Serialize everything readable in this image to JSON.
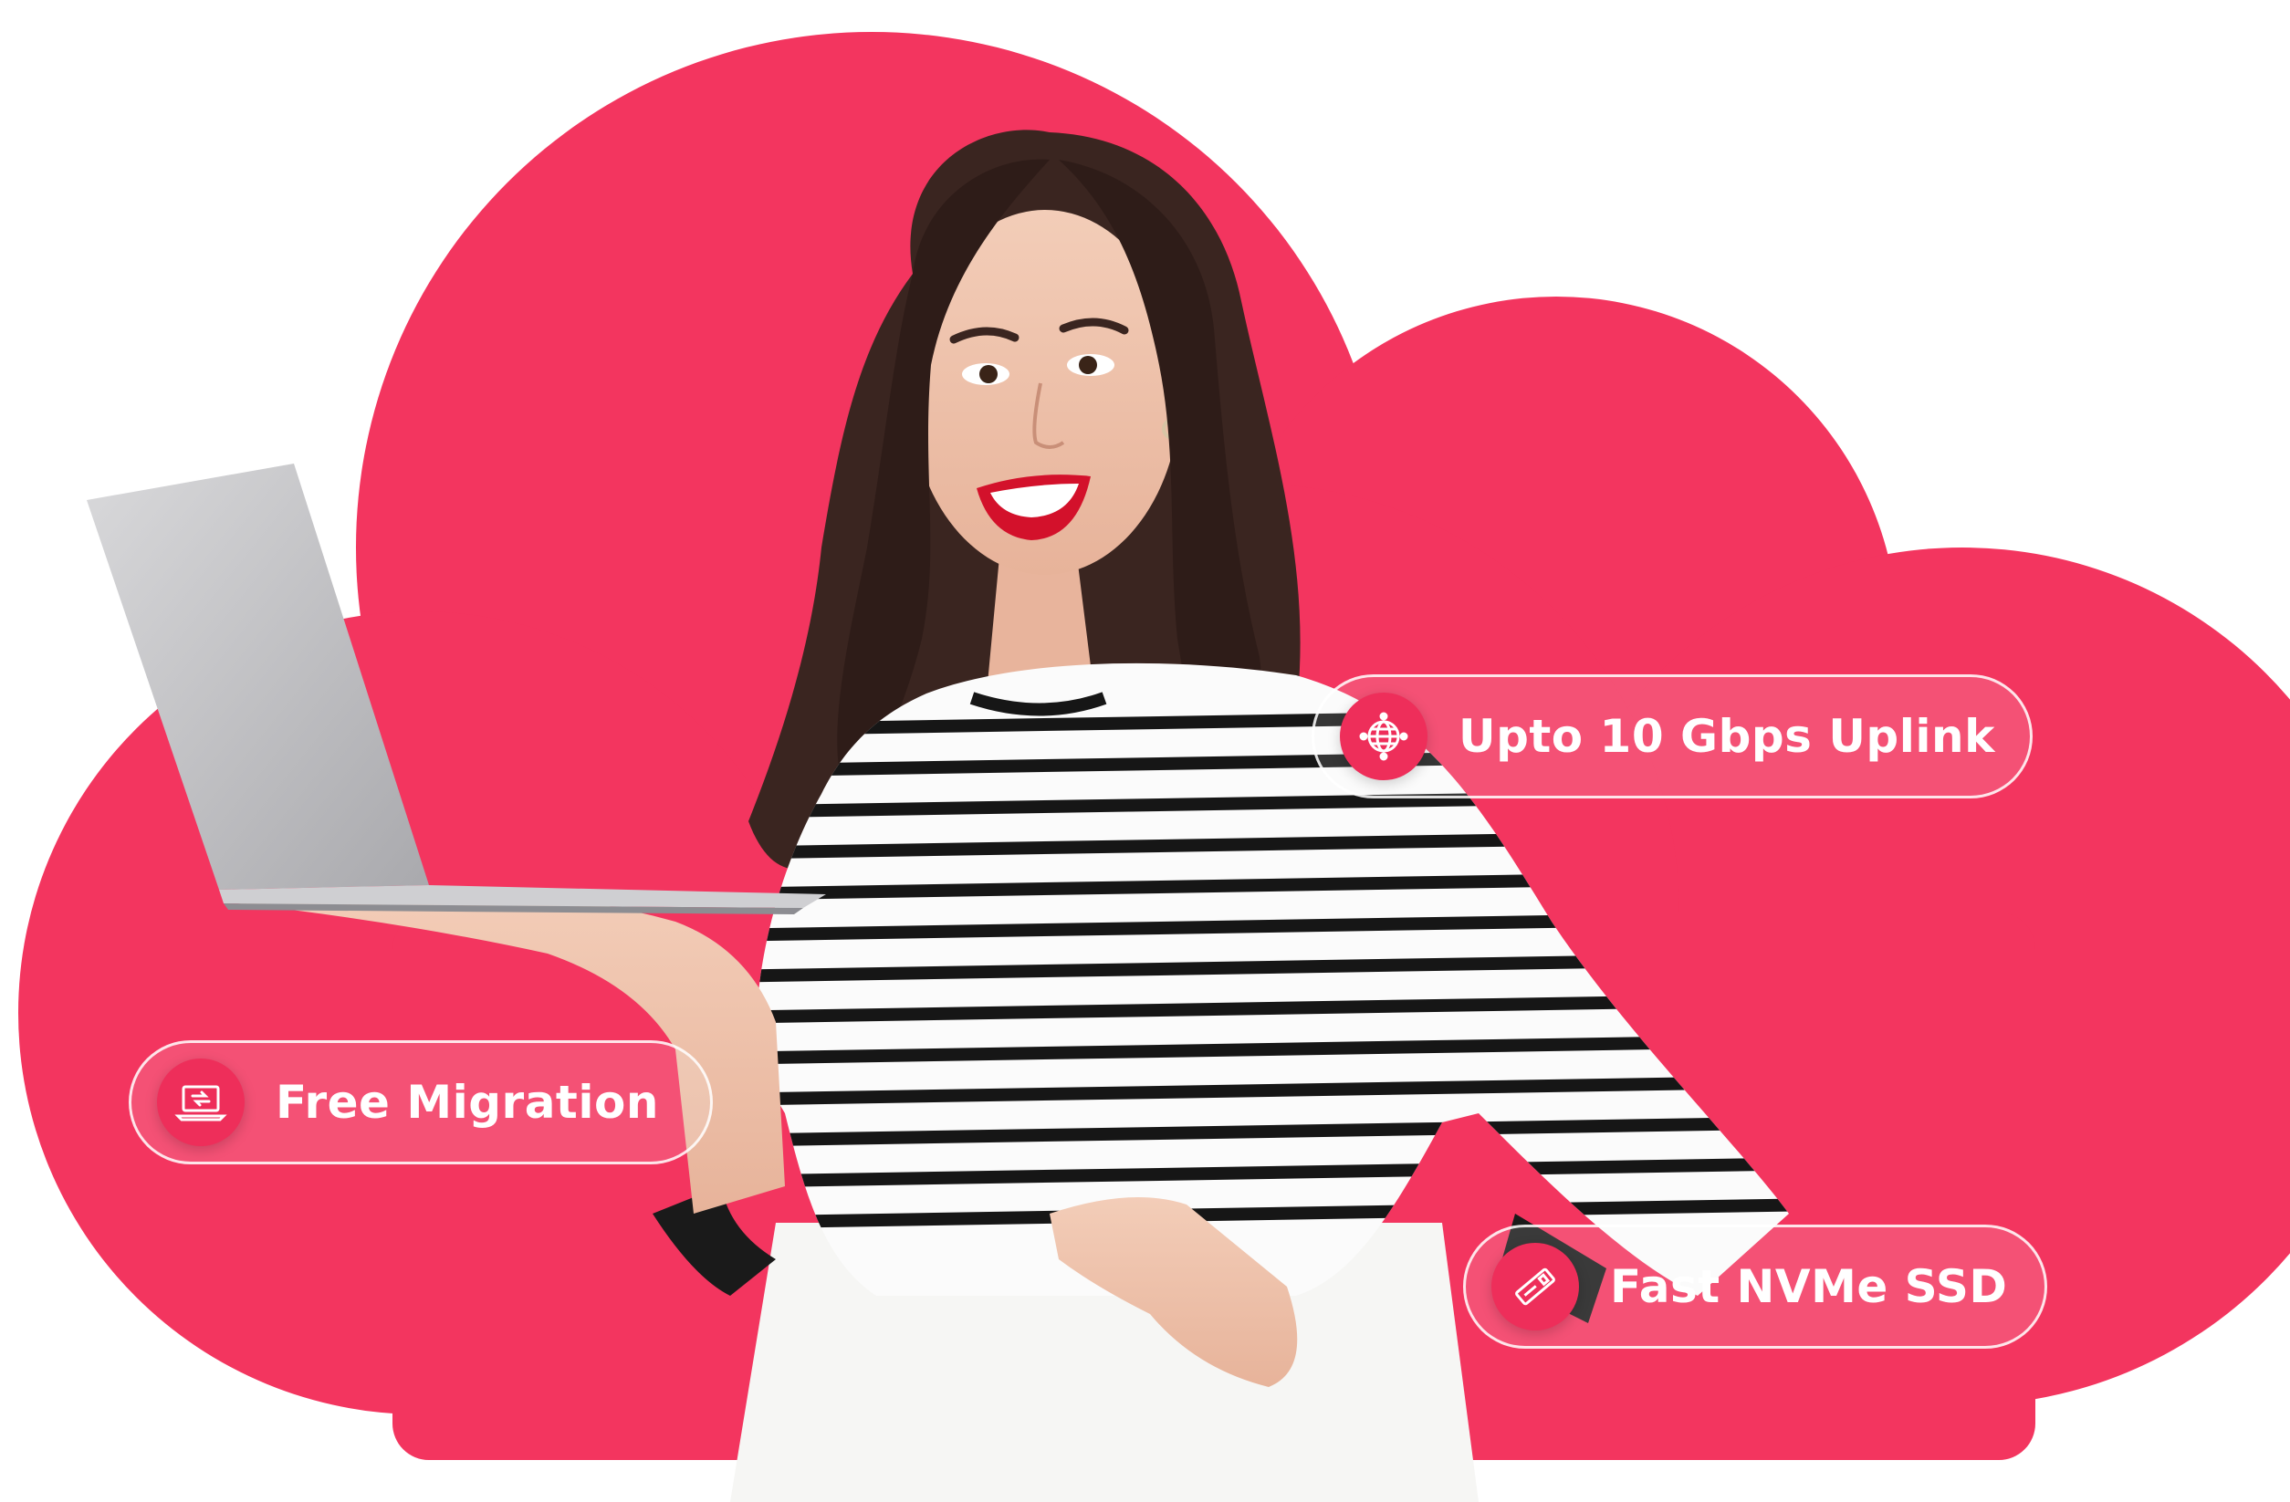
{
  "colors": {
    "cloud": "#f3355f",
    "accent": "#ee2e5a",
    "text": "#ffffff"
  },
  "badges": [
    {
      "label": "Upto 10 Gbps Uplink",
      "icon": "globe-icon"
    },
    {
      "label": "Free Migration",
      "icon": "laptop-migration-icon"
    },
    {
      "label": "Fast NVMe SSD",
      "icon": "ssd-drive-icon"
    }
  ]
}
